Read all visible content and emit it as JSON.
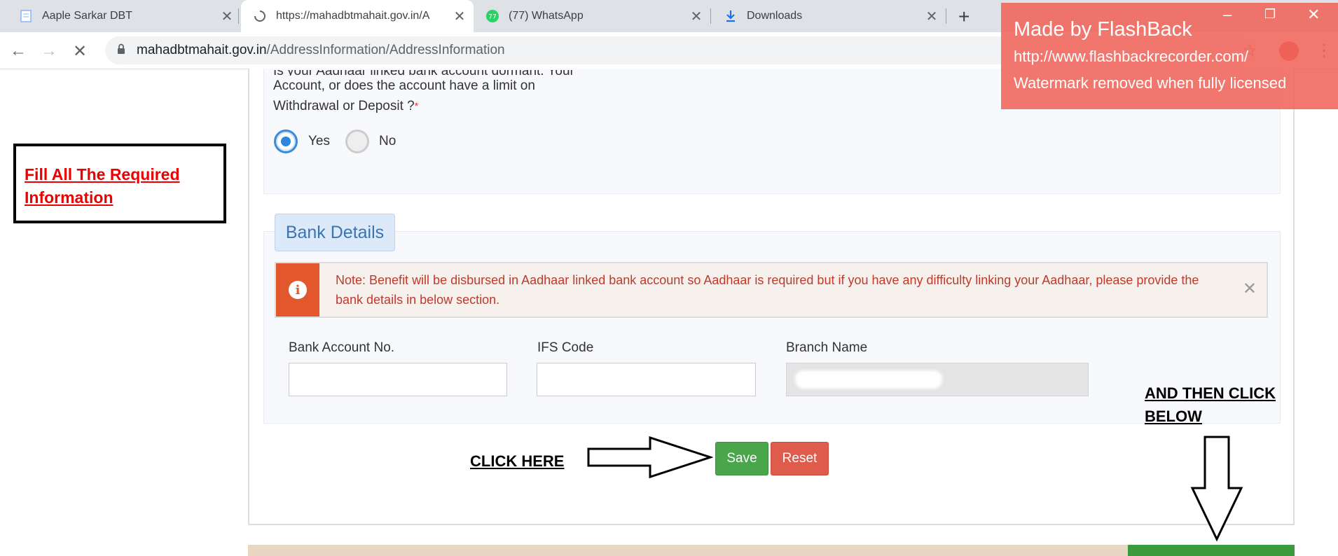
{
  "browser": {
    "tabs": [
      {
        "title": "Aaple Sarkar DBT",
        "active": false
      },
      {
        "title": "https://mahadbtmahait.gov.in/A",
        "active": true
      },
      {
        "title": "(77) WhatsApp",
        "active": false
      },
      {
        "title": "Downloads",
        "active": false
      }
    ],
    "whatsapp_badge": "77",
    "new_tab": "+",
    "close_glyph": "✕",
    "url_host": "mahadbtmahait.gov.in",
    "url_path": "/AddressInformation/AddressInformation",
    "back": "←",
    "forward": "→",
    "stop": "✕",
    "star": "☆",
    "menu": "⋮"
  },
  "watermark": {
    "line1": "Made by FlashBack",
    "line2": "http://www.flashbackrecorder.com/",
    "line3": "Watermark removed when fully licensed"
  },
  "question": {
    "line1": "Is your Aadhaar linked bank account dormant. Your",
    "line2": "Account, or does the account have a limit on",
    "line3": "Withdrawal or Deposit ?",
    "required": "*",
    "yes": "Yes",
    "no": "No",
    "selected": "Yes"
  },
  "bank": {
    "heading": "Bank Details",
    "alert_icon": "i",
    "alert": "Note: Benefit will be disbursed in Aadhaar linked bank account so Aadhaar is required but if you have any difficulty linking your Aadhaar, please provide the bank details in below section.",
    "alert_close": "✕",
    "account_label": "Bank Account No.",
    "ifsc_label": "IFS Code",
    "branch_label": "Branch Name"
  },
  "buttons": {
    "save": "Save",
    "reset": "Reset"
  },
  "annotations": {
    "note_line1": "Fill All The Required",
    "note_line2": "Information",
    "click_here": "CLICK HERE",
    "and_then_1": "AND THEN CLICK",
    "and_then_2": "BELOW"
  },
  "colors": {
    "save": "#4aa64a",
    "reset": "#df5b4b",
    "alert": "#e2572b",
    "note_text": "#ee0000",
    "watermark": "#f0645a"
  }
}
